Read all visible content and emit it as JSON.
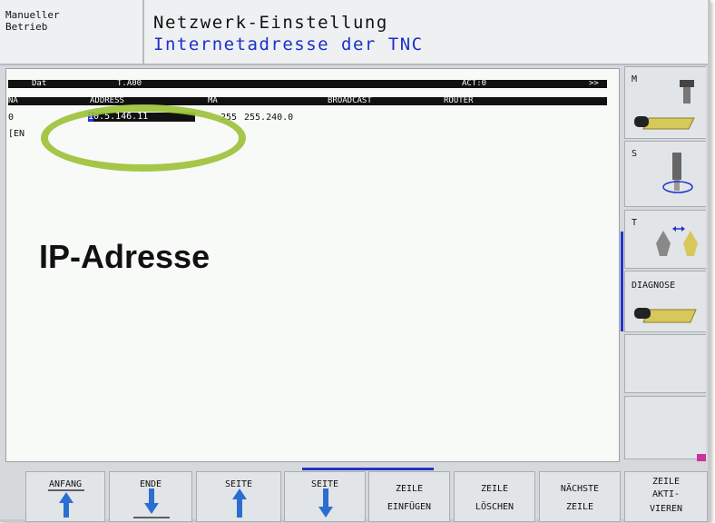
{
  "mode": {
    "label": "Manueller\nBetrieb"
  },
  "header": {
    "title": "Netzwerk-Einstellung",
    "subtitle": "Internetadresse der TNC"
  },
  "table": {
    "header_bar": {
      "left": "Dat",
      "middle": "T.A00",
      "act": "ACT:0",
      "more": ">>"
    },
    "columns": [
      "NA",
      "ADDRESS",
      "MA",
      "BROADCAST",
      "ROUTER"
    ],
    "row": {
      "index": "0",
      "address_cursor": "1",
      "address": "0.5.146.11",
      "mask_a": "255",
      "mask_b": "255.240.0"
    },
    "end_marker": "[EN"
  },
  "annotation": {
    "label": "IP-Adresse"
  },
  "right_softkeys": [
    {
      "label": "M"
    },
    {
      "label": "S"
    },
    {
      "label": "T"
    },
    {
      "label": "DIAGNOSE"
    },
    {
      "label": ""
    },
    {
      "label": ""
    }
  ],
  "bottom_softkeys": [
    {
      "line1": "ANFANG",
      "line2": ""
    },
    {
      "line1": "ENDE",
      "line2": ""
    },
    {
      "line1": "SEITE",
      "line2": ""
    },
    {
      "line1": "SEITE",
      "line2": ""
    },
    {
      "line1": "ZEILE",
      "line2": "EINFÜGEN"
    },
    {
      "line1": "ZEILE",
      "line2": "LÖSCHEN"
    },
    {
      "line1": "NÄCHSTE",
      "line2": "ZEILE"
    },
    {
      "line1": "ZEILE",
      "line2": "AKTI-",
      "line3": "VIEREN"
    }
  ],
  "colors": {
    "accent": "#2233cc",
    "highlight_ring": "#9cc23a",
    "background": "#d6d9dc"
  }
}
